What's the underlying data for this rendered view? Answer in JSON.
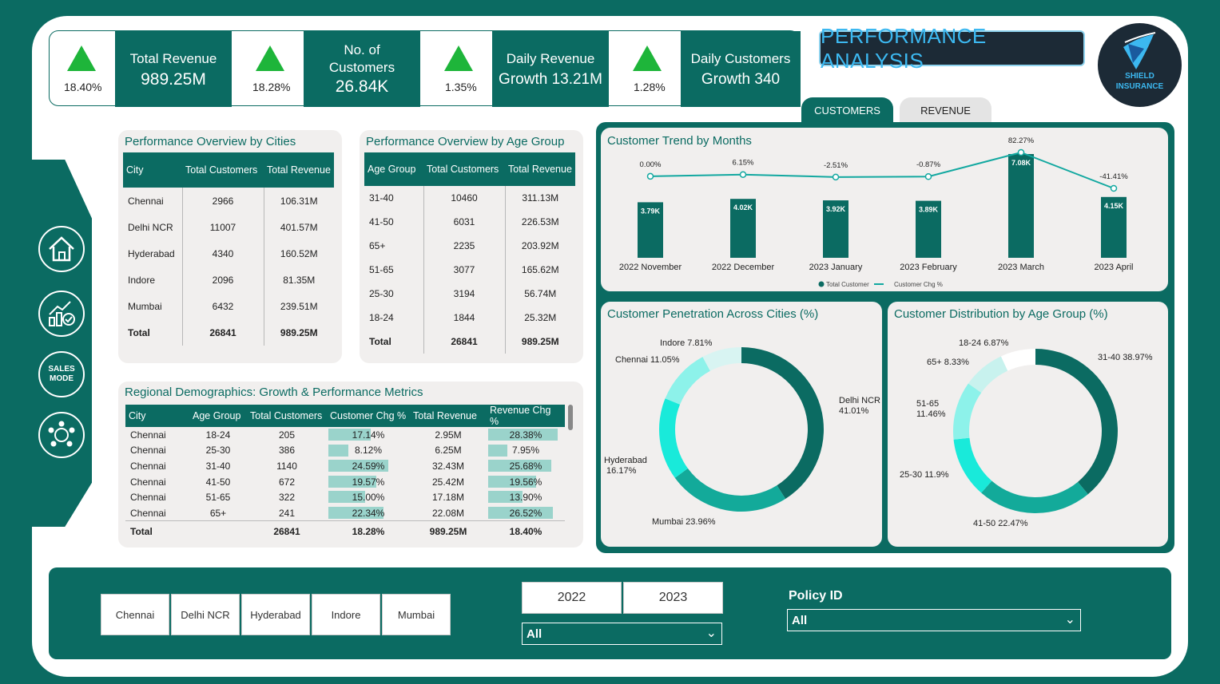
{
  "kpis": [
    {
      "pct": "18.40%",
      "label": "Total Revenue",
      "value": "989.25M"
    },
    {
      "pct": "18.28%",
      "label": "No. of Customers",
      "value": "26.84K"
    },
    {
      "pct": "1.35%",
      "label": "Daily Revenue",
      "value": "Growth 13.21M"
    },
    {
      "pct": "1.28%",
      "label": "Daily Customers",
      "value": "Growth 340"
    }
  ],
  "header": {
    "title": "PERFORMANCE ANALYSIS",
    "logo_line1": "SHIELD",
    "logo_line2": "INSURANCE"
  },
  "nav": {
    "sales_mode_label": "SALES MODE"
  },
  "tabs": {
    "customers": "CUSTOMERS",
    "revenue": "REVENUE"
  },
  "cities_table": {
    "title": "Performance Overview by Cities",
    "headers": [
      "City",
      "Total Customers",
      "Total Revenue"
    ],
    "rows": [
      [
        "Chennai",
        "2966",
        "106.31M"
      ],
      [
        "Delhi NCR",
        "11007",
        "401.57M"
      ],
      [
        "Hyderabad",
        "4340",
        "160.52M"
      ],
      [
        "Indore",
        "2096",
        "81.35M"
      ],
      [
        "Mumbai",
        "6432",
        "239.51M"
      ]
    ],
    "total": [
      "Total",
      "26841",
      "989.25M"
    ]
  },
  "age_table": {
    "title": "Performance Overview by Age Group",
    "headers": [
      "Age Group",
      "Total Customers",
      "Total Revenue"
    ],
    "rows": [
      [
        "31-40",
        "10460",
        "311.13M"
      ],
      [
        "41-50",
        "6031",
        "226.53M"
      ],
      [
        "65+",
        "2235",
        "203.92M"
      ],
      [
        "51-65",
        "3077",
        "165.62M"
      ],
      [
        "25-30",
        "3194",
        "56.74M"
      ],
      [
        "18-24",
        "1844",
        "25.32M"
      ]
    ],
    "total": [
      "Total",
      "26841",
      "989.25M"
    ]
  },
  "regional_table": {
    "title": "Regional Demographics: Growth & Performance Metrics",
    "headers": [
      "City",
      "Age Group",
      "Total Customers",
      "Customer Chg %",
      "Total Revenue",
      "Revenue Chg %"
    ],
    "rows": [
      [
        "Chennai",
        "18-24",
        "205",
        "17.14%",
        "2.95M",
        "28.38%"
      ],
      [
        "Chennai",
        "25-30",
        "386",
        "8.12%",
        "6.25M",
        "7.95%"
      ],
      [
        "Chennai",
        "31-40",
        "1140",
        "24.59%",
        "32.43M",
        "25.68%"
      ],
      [
        "Chennai",
        "41-50",
        "672",
        "19.57%",
        "25.42M",
        "19.56%"
      ],
      [
        "Chennai",
        "51-65",
        "322",
        "15.00%",
        "17.18M",
        "13.90%"
      ],
      [
        "Chennai",
        "65+",
        "241",
        "22.34%",
        "22.08M",
        "26.52%"
      ]
    ],
    "total": [
      "Total",
      "",
      "26841",
      "18.28%",
      "989.25M",
      "18.40%"
    ]
  },
  "trend_chart": {
    "title": "Customer Trend by Months",
    "legend_bar": "Total Customer",
    "legend_line": "Customer Chg %"
  },
  "penetration_chart": {
    "title": "Customer Penetration Across Cities (%)"
  },
  "distribution_chart": {
    "title": "Customer Distribution by Age Group (%)"
  },
  "chart_data": [
    {
      "type": "bar",
      "title": "Customer Trend by Months",
      "categories": [
        "2022 November",
        "2022 December",
        "2023 January",
        "2023 February",
        "2023 March",
        "2023 April"
      ],
      "series": [
        {
          "name": "Total Customer",
          "type": "bar",
          "values": [
            3.79,
            4.02,
            3.92,
            3.89,
            7.08,
            4.15
          ],
          "labels": [
            "3.79K",
            "4.02K",
            "3.92K",
            "3.89K",
            "7.08K",
            "4.15K"
          ]
        },
        {
          "name": "Customer Chg %",
          "type": "line",
          "values": [
            0.0,
            6.15,
            -2.51,
            -0.87,
            82.27,
            -41.41
          ],
          "labels": [
            "0.00%",
            "6.15%",
            "-2.51%",
            "-0.87%",
            "82.27%",
            "-41.41%"
          ]
        }
      ],
      "legend": "bottom"
    },
    {
      "type": "pie",
      "title": "Customer Penetration Across Cities (%)",
      "categories": [
        "Delhi NCR",
        "Mumbai",
        "Hyderabad",
        "Chennai",
        "Indore"
      ],
      "values": [
        41.01,
        23.96,
        16.17,
        11.05,
        7.81
      ],
      "colors": [
        "#0b6b62",
        "#13aa9a",
        "#19eada",
        "#8df2ea",
        "#d8f4f2"
      ]
    },
    {
      "type": "pie",
      "title": "Customer Distribution by Age Group (%)",
      "categories": [
        "31-40",
        "41-50",
        "25-30",
        "51-65",
        "65+",
        "18-24"
      ],
      "values": [
        38.97,
        22.47,
        11.9,
        11.46,
        8.33,
        6.87
      ],
      "colors": [
        "#0b6b62",
        "#13aa9a",
        "#19eada",
        "#8df2ea",
        "#c8f2ee",
        "#ffffff"
      ]
    }
  ],
  "filters": {
    "cities": [
      "Chennai",
      "Delhi NCR",
      "Hyderabad",
      "Indore",
      "Mumbai"
    ],
    "years": [
      "2022",
      "2023"
    ],
    "year_dropdown_value": "All",
    "policy_label": "Policy ID",
    "policy_value": "All"
  },
  "colors": {
    "primary": "#0b6b62",
    "accent": "#1eb53a",
    "panel": "#f1efee",
    "line": "#12a8a0"
  }
}
